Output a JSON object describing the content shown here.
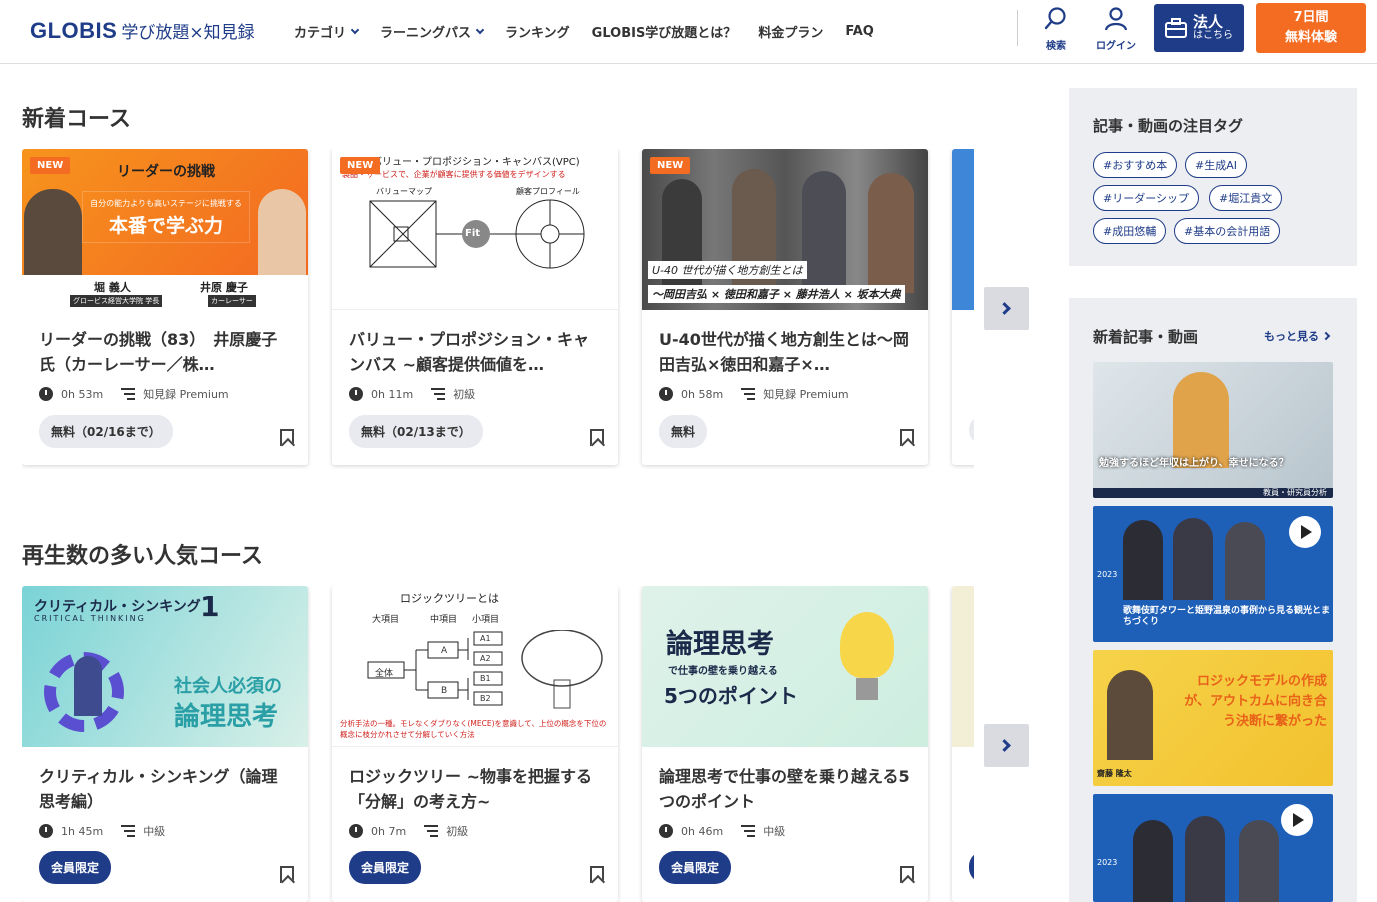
{
  "header": {
    "logo": "GLOBIS",
    "logo_sub": "学び放題×知見録",
    "nav": [
      {
        "label": "カテゴリ",
        "dropdown": true
      },
      {
        "label": "ラーニングパス",
        "dropdown": true
      },
      {
        "label": "ランキング",
        "dropdown": false
      },
      {
        "label": "GLOBIS学び放題とは？",
        "dropdown": false
      },
      {
        "label": "料金プラン",
        "dropdown": false
      },
      {
        "label": "FAQ",
        "dropdown": false
      }
    ],
    "search_label": "検索",
    "login_label": "ログイン",
    "corp_label": "法人",
    "corp_sub": "はこちら",
    "trial_line1": "7日間",
    "trial_line2": "無料体験"
  },
  "new_courses": {
    "title": "新着コース",
    "cards": [
      {
        "badge": "NEW",
        "title": "リーダーの挑戦（83）　井原慶子氏（カーレーサー／株…",
        "duration": "0h 53m",
        "level": "知見録 Premium",
        "pill": "無料（02/16まで）",
        "pill_type": "free",
        "thumb": {
          "heading": "リーダーの挑戦",
          "sub": "自分の能力よりも高いステージに挑戦する",
          "main": "本番で学ぶ力",
          "name1": "堀 義人",
          "role1": "グロービス経営大学院 学長",
          "name2": "井原 慶子",
          "role2": "カーレーサー"
        }
      },
      {
        "badge": "NEW",
        "title": "バリュー・プロポジション・キャンバス ~顧客提供価値を…",
        "duration": "0h 11m",
        "level": "初級",
        "pill": "無料（02/13まで）",
        "pill_type": "free",
        "thumb": {
          "heading": "バリュー・プロポジション・キャンバス(VPC)",
          "sub": "製品・サービスで、企業が顧客に提供する価値をデザインする",
          "left": "バリューマップ",
          "right": "顧客プロフィール",
          "center": "Fit"
        }
      },
      {
        "badge": "NEW",
        "title": "U-40世代が描く地方創生とは～岡田吉弘×徳田和嘉子×…",
        "duration": "0h 58m",
        "level": "知見録 Premium",
        "pill": "無料",
        "pill_type": "free",
        "thumb": {
          "caption1": "U-40 世代が描く地方創生とは",
          "caption2": "～岡田吉弘 × 徳田和嘉子 × 藤井浩人 × 坂本大典"
        }
      }
    ]
  },
  "popular_courses": {
    "title": "再生数の多い人気コース",
    "cards": [
      {
        "title": "クリティカル・シンキング（論理思考編）",
        "duration": "1h 45m",
        "level": "中級",
        "pill": "会員限定",
        "pill_type": "member",
        "thumb": {
          "heading": "クリティカル・シンキング",
          "num": "1",
          "en": "CRITICAL THINKING",
          "main1": "社会人必須の",
          "main2": "論理思考"
        }
      },
      {
        "title": "ロジックツリー ~物事を把握する「分解」の考え方~",
        "duration": "0h 7m",
        "level": "初級",
        "pill": "会員限定",
        "pill_type": "member",
        "thumb": {
          "heading": "ロジックツリーとは",
          "c1": "大項目",
          "c2": "中項目",
          "c3": "小項目",
          "root": "全体",
          "a": "A",
          "b": "B",
          "a1": "A1",
          "a2": "A2",
          "b1": "B1",
          "b2": "B2",
          "note": "分析手法の一種。モレなくダブりなく(MECE)を意識して、上位の概念を下位の概念に枝分かれさせて分解していく方法"
        }
      },
      {
        "title": "論理思考で仕事の壁を乗り越える5つのポイント",
        "duration": "0h 46m",
        "level": "中級",
        "pill": "会員限定",
        "pill_type": "member",
        "thumb": {
          "main": "論理思考",
          "sub": "で仕事の壁を乗り越える",
          "points": "5つのポイント"
        }
      }
    ]
  },
  "sidebar": {
    "tags_title": "記事・動画の注目タグ",
    "tags": [
      "#おすすめ本",
      "#生成AI",
      "#リーダーシップ",
      "#堀江貴文",
      "#成田悠輔",
      "#基本の会計用語"
    ],
    "new_title": "新着記事・動画",
    "more": "もっと見る",
    "items": [
      {
        "caption": "勉強するほど年収は上がり、幸せになる？",
        "label": "教員・研究員分析"
      },
      {
        "caption": "歌舞伎町タワーと姫野温泉の事例から見る観光とまちづくり",
        "label": "2023"
      },
      {
        "caption": "ロジックモデルの作成が、アウトカムに向き合う決断に繋がった",
        "label": "齋藤 隆太"
      },
      {
        "caption": "",
        "label": "2023"
      }
    ]
  },
  "colors": {
    "brand": "#1f3c88",
    "accent": "#f36c21"
  }
}
